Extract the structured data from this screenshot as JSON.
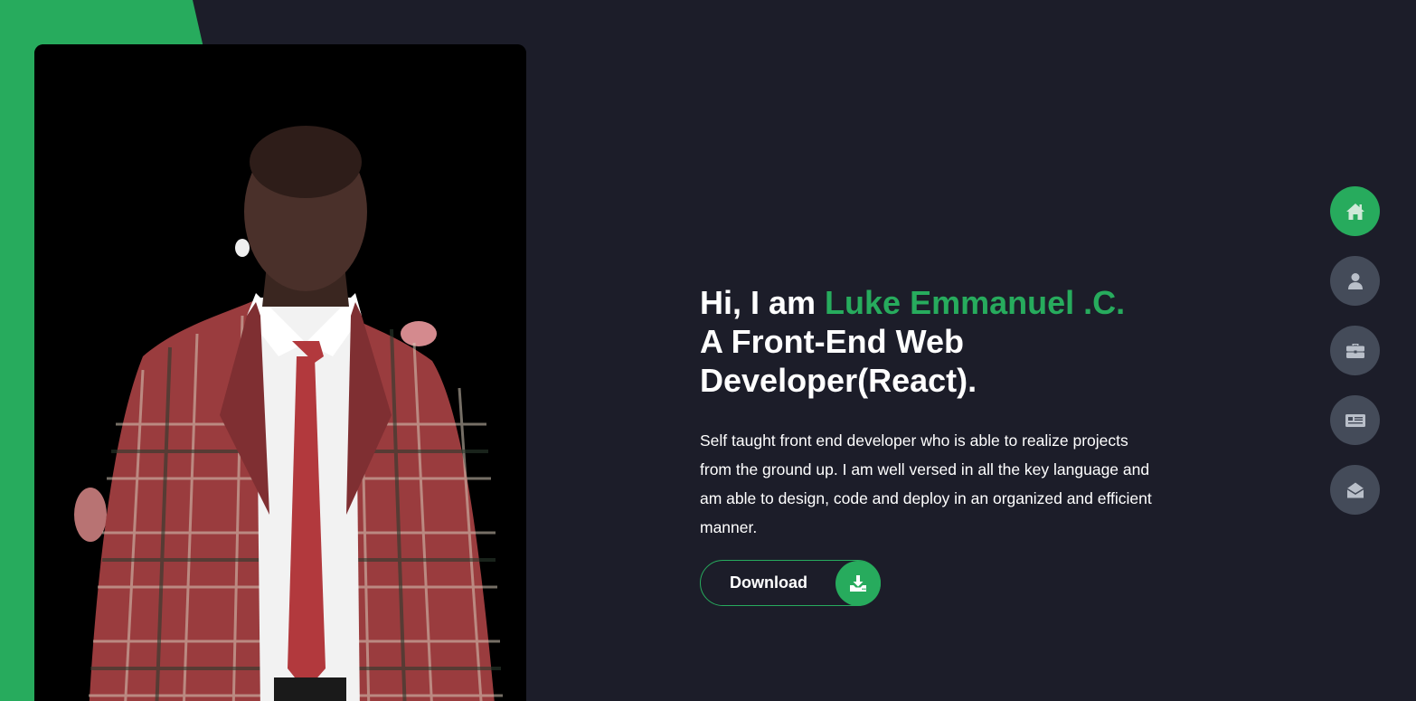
{
  "colors": {
    "background": "#1c1d29",
    "accent": "#27ab5d",
    "nav_inactive": "#444b59",
    "icon_inactive": "#b9bfc9",
    "text": "#ffffff"
  },
  "hero": {
    "greeting": "Hi, I am ",
    "name": "Luke Emmanuel .C.",
    "role_line1": "A Front-End Web",
    "role_line2": "Developer(React).",
    "description": "Self taught front end developer who is able to realize projects from the ground up. I am well versed in all the key language and am able to design, code and deploy in an organized and efficient manner."
  },
  "download": {
    "label": "Download",
    "icon": "download-icon"
  },
  "photo": {
    "subject": "portrait-photo"
  },
  "side_nav": [
    {
      "id": "home",
      "icon": "home-icon",
      "active": true
    },
    {
      "id": "about",
      "icon": "user-icon",
      "active": false
    },
    {
      "id": "portfolio",
      "icon": "briefcase-icon",
      "active": false
    },
    {
      "id": "blog",
      "icon": "newspaper-icon",
      "active": false
    },
    {
      "id": "contact",
      "icon": "envelope-open-icon",
      "active": false
    }
  ]
}
